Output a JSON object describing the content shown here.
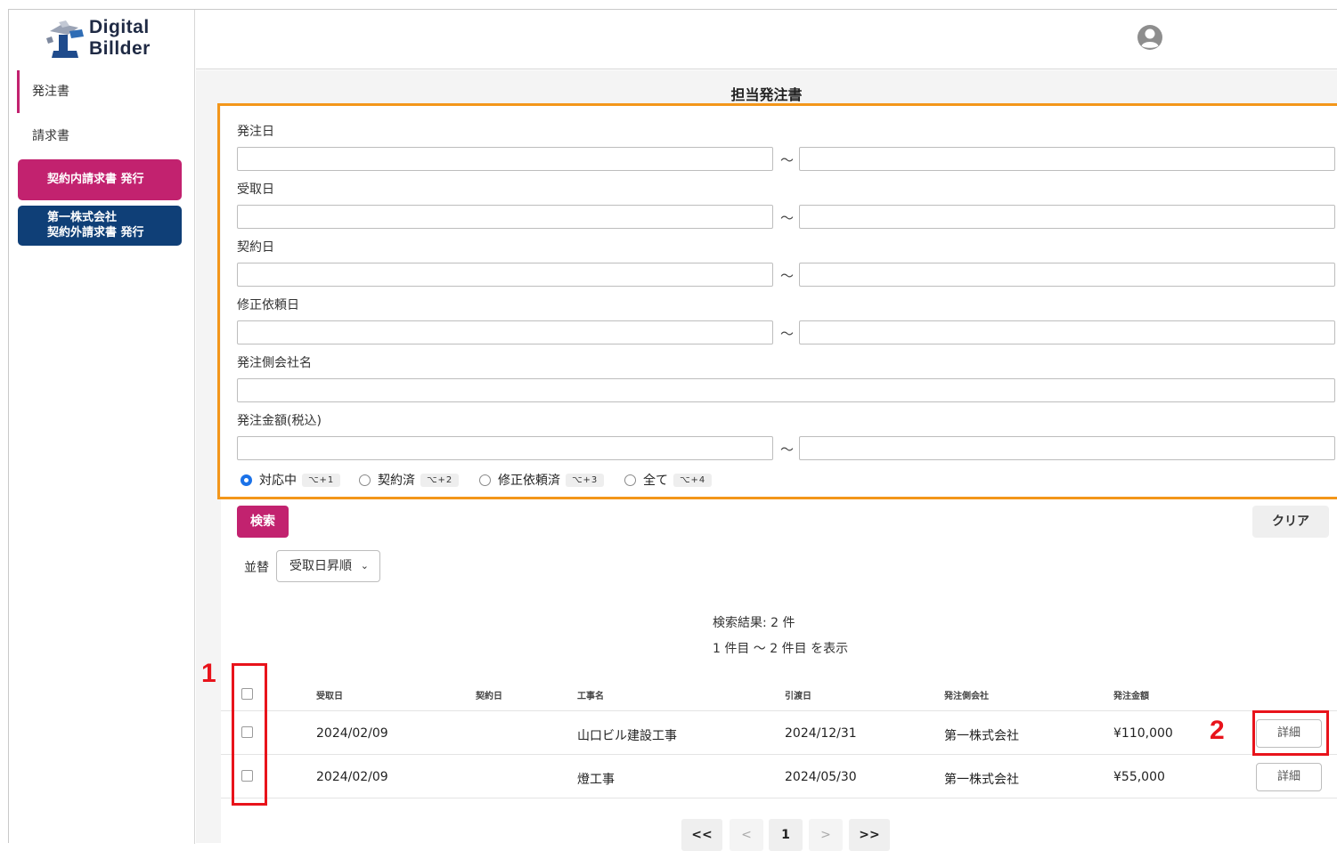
{
  "brand": {
    "line1": "Digital",
    "line2": "Billder"
  },
  "sidebar": {
    "items": [
      {
        "label": "発注書",
        "active": true
      },
      {
        "label": "請求書",
        "active": false
      }
    ],
    "buttons": [
      {
        "label": "契約内請求書 発行",
        "color": "#c2226f"
      },
      {
        "line1": "第一株式会社",
        "line2": "契約外請求書 発行",
        "color": "#0f3f77"
      }
    ]
  },
  "page": {
    "title": "担当発注書"
  },
  "filters": {
    "order_date": {
      "label": "発注日",
      "from": "",
      "to": ""
    },
    "receive_date": {
      "label": "受取日",
      "from": "",
      "to": ""
    },
    "contract_date": {
      "label": "契約日",
      "from": "",
      "to": ""
    },
    "revision_date": {
      "label": "修正依頼日",
      "from": "",
      "to": ""
    },
    "orderer_company": {
      "label": "発注側会社名",
      "value": ""
    },
    "order_amount": {
      "label": "発注金額(税込)",
      "from": "",
      "to": ""
    },
    "range_separator": "～",
    "status_options": [
      {
        "label": "対応中",
        "shortcut": "⌥+1",
        "selected": true
      },
      {
        "label": "契約済",
        "shortcut": "⌥+2",
        "selected": false
      },
      {
        "label": "修正依頼済",
        "shortcut": "⌥+3",
        "selected": false
      },
      {
        "label": "全て",
        "shortcut": "⌥+4",
        "selected": false
      }
    ]
  },
  "actions": {
    "search": "検索",
    "clear": "クリア"
  },
  "sort": {
    "label": "並替",
    "selected": "受取日昇順"
  },
  "results": {
    "count_text": "検索結果: 2 件",
    "range_text": "1 件目 ～ 2 件目 を表示"
  },
  "table": {
    "columns": [
      "受取日",
      "契約日",
      "工事名",
      "引渡日",
      "発注側会社",
      "発注金額"
    ],
    "rows": [
      {
        "received": "2024/02/09",
        "contract": "",
        "project": "山口ビル建設工事",
        "delivery": "2024/12/31",
        "company": "第一株式会社",
        "amount": "¥110,000",
        "action": "詳細"
      },
      {
        "received": "2024/02/09",
        "contract": "",
        "project": "燈工事",
        "delivery": "2024/05/30",
        "company": "第一株式会社",
        "amount": "¥55,000",
        "action": "詳細"
      }
    ]
  },
  "pagination": {
    "first": "<<",
    "prev": "<",
    "current": "1",
    "next": ">",
    "last": ">>"
  },
  "annotations": {
    "one": "1",
    "two": "2",
    "color": "#e8131b"
  },
  "colors": {
    "accent_pink": "#c2226f",
    "accent_navy": "#0f3f77",
    "highlight_orange": "#f3961a"
  }
}
